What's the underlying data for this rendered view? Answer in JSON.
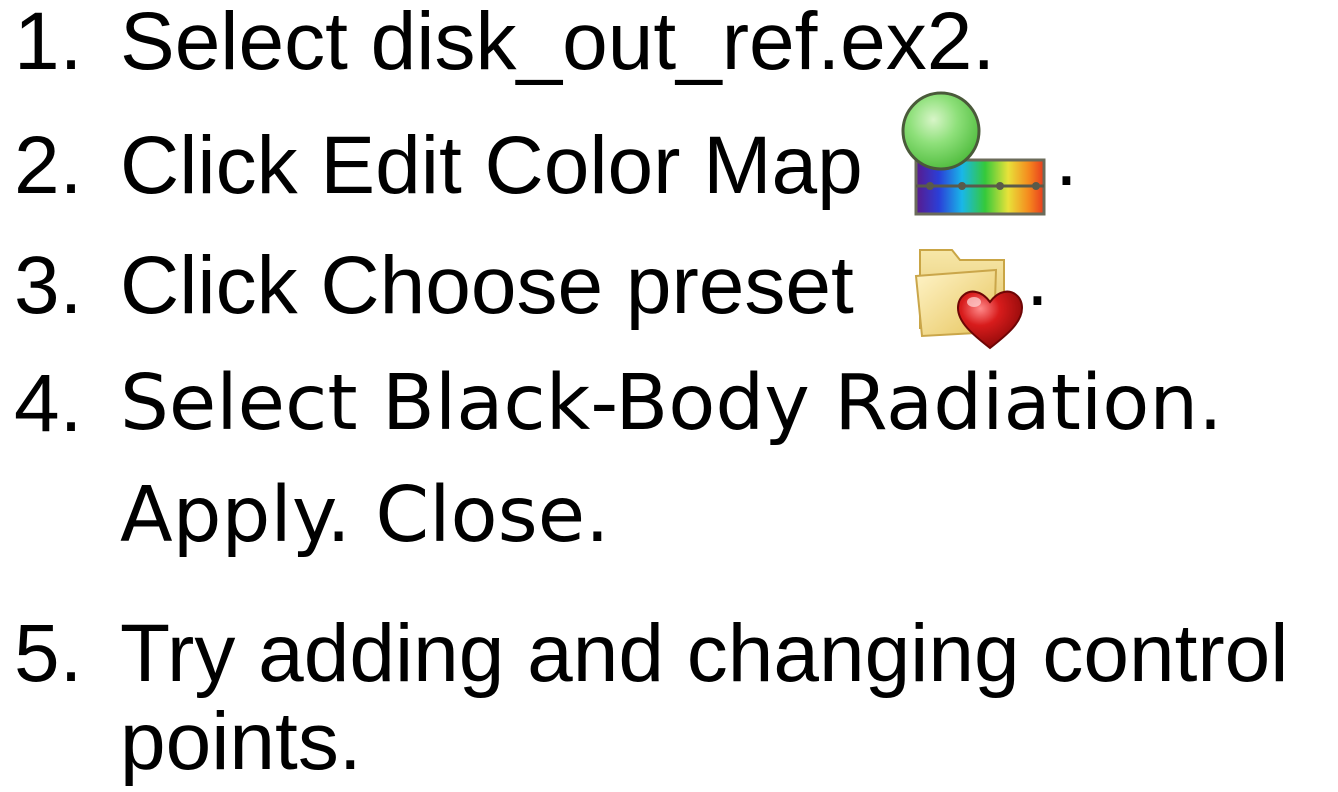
{
  "steps": [
    {
      "number": "1.",
      "text": "Select disk_out_ref.ex2."
    },
    {
      "number": "2.",
      "text": "Click Edit Color Map",
      "icon": "edit-color-map-icon",
      "suffix": "."
    },
    {
      "number": "3.",
      "text": "Click Choose preset",
      "icon": "choose-preset-icon",
      "suffix": "."
    },
    {
      "number": "4.",
      "text": "Select Black-Body Radiation.",
      "continuation": "Apply. Close."
    },
    {
      "number": "5.",
      "text": "Try adding and changing control",
      "continuation": "points."
    }
  ]
}
